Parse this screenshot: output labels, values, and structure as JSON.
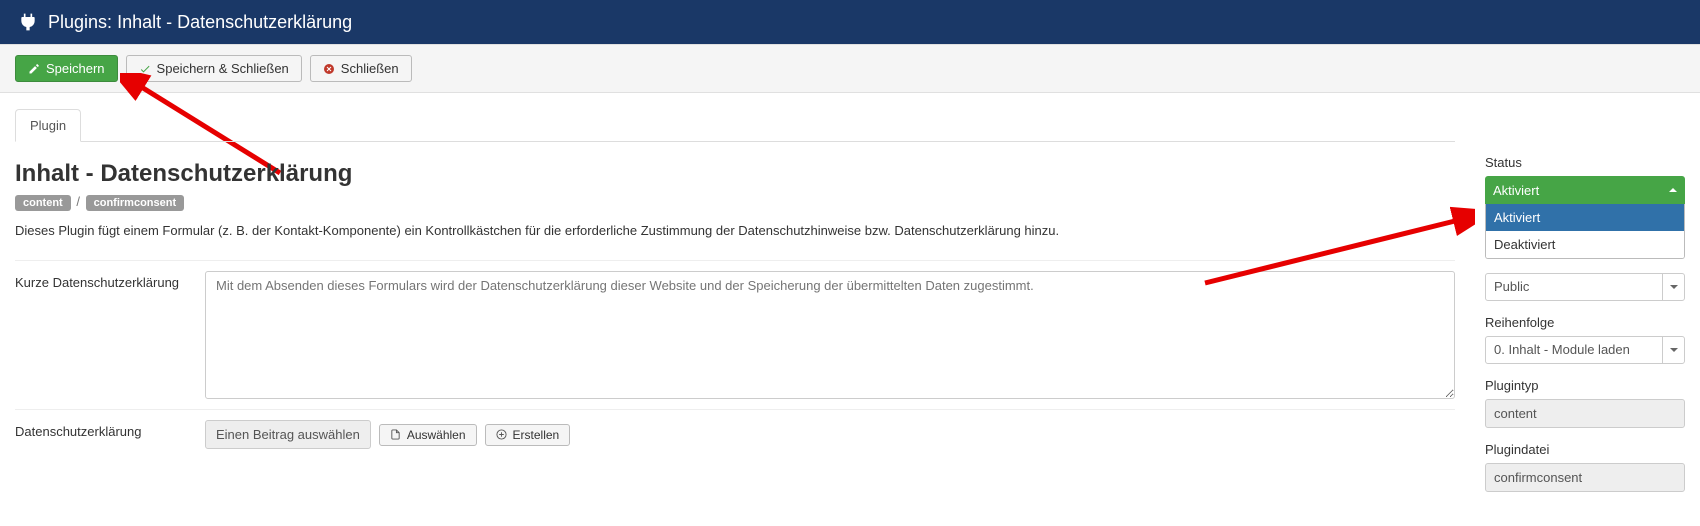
{
  "header": {
    "prefix": "Plugins:",
    "title": "Inhalt - Datenschutzerklärung"
  },
  "toolbar": {
    "save": "Speichern",
    "save_close": "Speichern & Schließen",
    "close": "Schließen"
  },
  "tabs": {
    "plugin": "Plugin"
  },
  "page": {
    "heading": "Inhalt - Datenschutzerklärung",
    "chip_folder": "content",
    "chip_element": "confirmconsent",
    "separator": "/",
    "description": "Dieses Plugin fügt einem Formular (z. B. der Kontakt-Komponente) ein Kontrollkästchen für die erforderliche Zustimmung der Datenschutzhinweise bzw. Datenschutzerklärung hinzu."
  },
  "fields": {
    "short_label": "Kurze Datenschutzerklärung",
    "short_placeholder": "Mit dem Absenden dieses Formulars wird der Datenschutzerklärung dieser Website und der Speicherung der übermittelten Daten zugestimmt.",
    "article_label": "Datenschutzerklärung",
    "article_value": "Einen Beitrag auswählen",
    "select_btn": "Auswählen",
    "create_btn": "Erstellen"
  },
  "side": {
    "status_label": "Status",
    "status_selected": "Aktiviert",
    "status_options": {
      "enabled": "Aktiviert",
      "disabled": "Deaktiviert"
    },
    "access_value": "Public",
    "ordering_label": "Reihenfolge",
    "ordering_value": "0. Inhalt - Module laden",
    "type_label": "Plugintyp",
    "type_value": "content",
    "file_label": "Plugindatei",
    "file_value": "confirmconsent"
  }
}
